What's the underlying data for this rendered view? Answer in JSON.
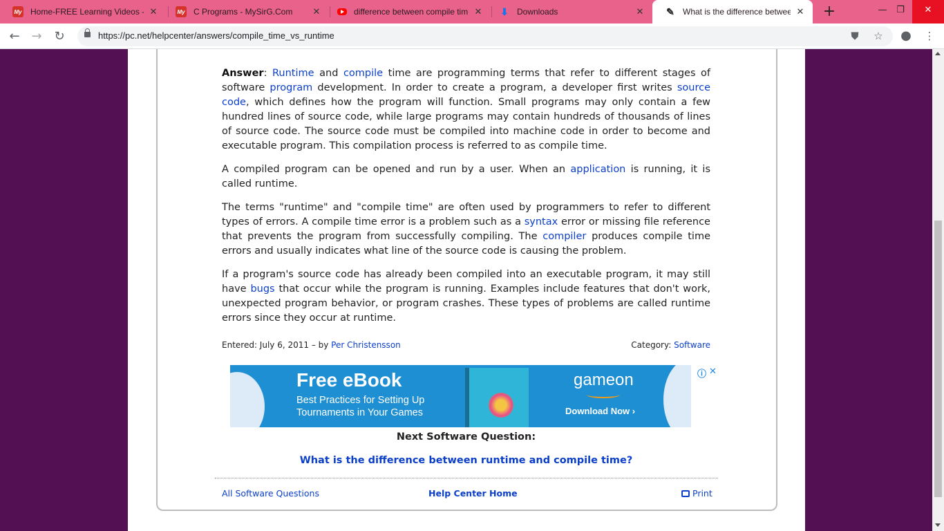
{
  "browser": {
    "tabs": [
      {
        "title": "Home-FREE Learning Videos - M",
        "icon": "mysirg-icon"
      },
      {
        "title": "C Programs - MySirG.Com",
        "icon": "mysirg-icon"
      },
      {
        "title": "difference between compile tim",
        "icon": "youtube-icon"
      },
      {
        "title": "Downloads",
        "icon": "download-icon"
      },
      {
        "title": "What is the difference between",
        "icon": "pc-icon"
      }
    ],
    "fav_text": "My",
    "url": "https://pc.net/helpcenter/answers/compile_time_vs_runtime",
    "tabstrip_color": "#e8628c",
    "page_background": "#531052"
  },
  "article": {
    "p1": {
      "answer_label": "Answer",
      "colon": ":",
      "runtime": "Runtime",
      "and": " and ",
      "compile": "compile",
      "t1": " time are programming terms that refer to different stages of software ",
      "program": "program",
      "t2": " development. In order to create a program, a developer first writes ",
      "source_code": "source code",
      "t3": ", which defines how the program will function. Small programs may only contain a few hundred lines of source code, while large programs may contain hundreds of thousands of lines of source code. The source code must be compiled into machine code in order to become and executable program. This compilation process is referred to as compile time."
    },
    "p2": {
      "t1": "A compiled program can be opened and run by a user. When an ",
      "application": "application",
      "t2": " is running, it is called runtime."
    },
    "p3": {
      "t1": "The terms \"runtime\" and \"compile time\" are often used by programmers to refer to different types of errors. A compile time error is a problem such as a ",
      "syntax": "syntax",
      "t2": " error or missing file reference that prevents the program from successfully compiling. The ",
      "compiler": "compiler",
      "t3": " produces compile time errors and usually indicates what line of the source code is causing the problem."
    },
    "p4": {
      "t1": "If a program's source code has already been compiled into an executable program, it may still have ",
      "bugs": "bugs",
      "t2": " that occur while the program is running. Examples include features that don't work, unexpected program behavior, or program crashes. These types of problems are called runtime errors since they occur at runtime."
    },
    "entered_text": "Entered: July 6, 2011 – by ",
    "author": "Per Christensson",
    "category_label": "Category: ",
    "category": "Software"
  },
  "ad": {
    "headline": "Free eBook",
    "subline": "Best Practices for Setting Up Tournaments in Your Games",
    "brand": "gameon",
    "cta": "Download Now ›",
    "choices_icon": "ⓘ",
    "close_icon": "✕"
  },
  "next": {
    "label": "Next Software Question:",
    "link": "What is the difference between runtime and compile time?"
  },
  "footer": {
    "all_questions": "All Software Questions",
    "help_home": "Help Center Home",
    "print": "Print"
  }
}
